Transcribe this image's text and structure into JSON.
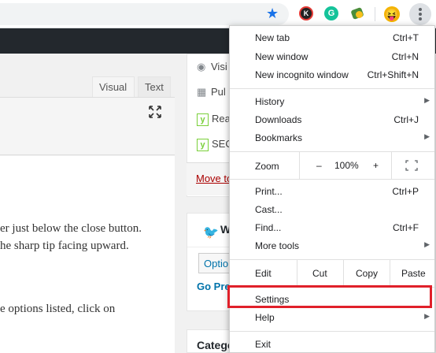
{
  "colors": {
    "accent_star": "#1a73e8",
    "highlight": "#e0202a",
    "wp_bar": "#23282d",
    "link": "#0073aa",
    "trash": "#aa0000"
  },
  "toolbar": {
    "star_icon": "star-icon",
    "extensions": [
      {
        "name": "k-extension-icon",
        "glyph": "K"
      },
      {
        "name": "grammarly-extension-icon",
        "glyph": "G"
      },
      {
        "name": "map-extension-icon",
        "glyph": ""
      }
    ],
    "avatar_glyph": "😝",
    "menu_icon": "kebab-menu-icon"
  },
  "editor": {
    "tabs": [
      {
        "label": "Visual"
      },
      {
        "label": "Text"
      }
    ],
    "body_lines": [
      "er just below the close button.",
      "he sharp tip facing upward.",
      "e options listed, click on"
    ]
  },
  "sidebar": {
    "publish": {
      "rows": [
        {
          "icon": "eye-icon",
          "text": "Visi"
        },
        {
          "icon": "calendar-icon",
          "text": "Pul"
        },
        {
          "icon": "yoast-icon",
          "text": "Rea"
        },
        {
          "icon": "yoast-icon",
          "text": "SEO"
        }
      ],
      "trash_link": "Move to"
    },
    "twitter": {
      "title": "W",
      "option": "Optio",
      "link": "Go Pre"
    },
    "categories": {
      "title": "Catego"
    }
  },
  "menu": {
    "group1": [
      {
        "label": "New tab",
        "shortcut": "Ctrl+T"
      },
      {
        "label": "New window",
        "shortcut": "Ctrl+N"
      },
      {
        "label": "New incognito window",
        "shortcut": "Ctrl+Shift+N"
      }
    ],
    "group2": [
      {
        "label": "History",
        "shortcut": "",
        "submenu": true
      },
      {
        "label": "Downloads",
        "shortcut": "Ctrl+J",
        "submenu": false
      },
      {
        "label": "Bookmarks",
        "shortcut": "",
        "submenu": true
      }
    ],
    "zoom": {
      "label": "Zoom",
      "minus": "–",
      "level": "100%",
      "plus": "+"
    },
    "group3": [
      {
        "label": "Print...",
        "shortcut": "Ctrl+P",
        "submenu": false
      },
      {
        "label": "Cast...",
        "shortcut": "",
        "submenu": false
      },
      {
        "label": "Find...",
        "shortcut": "Ctrl+F",
        "submenu": false
      },
      {
        "label": "More tools",
        "shortcut": "",
        "submenu": true
      }
    ],
    "edit": {
      "label": "Edit",
      "cut": "Cut",
      "copy": "Copy",
      "paste": "Paste"
    },
    "group4": [
      {
        "label": "Settings",
        "submenu": false
      },
      {
        "label": "Help",
        "submenu": true
      }
    ],
    "exit": {
      "label": "Exit"
    }
  }
}
